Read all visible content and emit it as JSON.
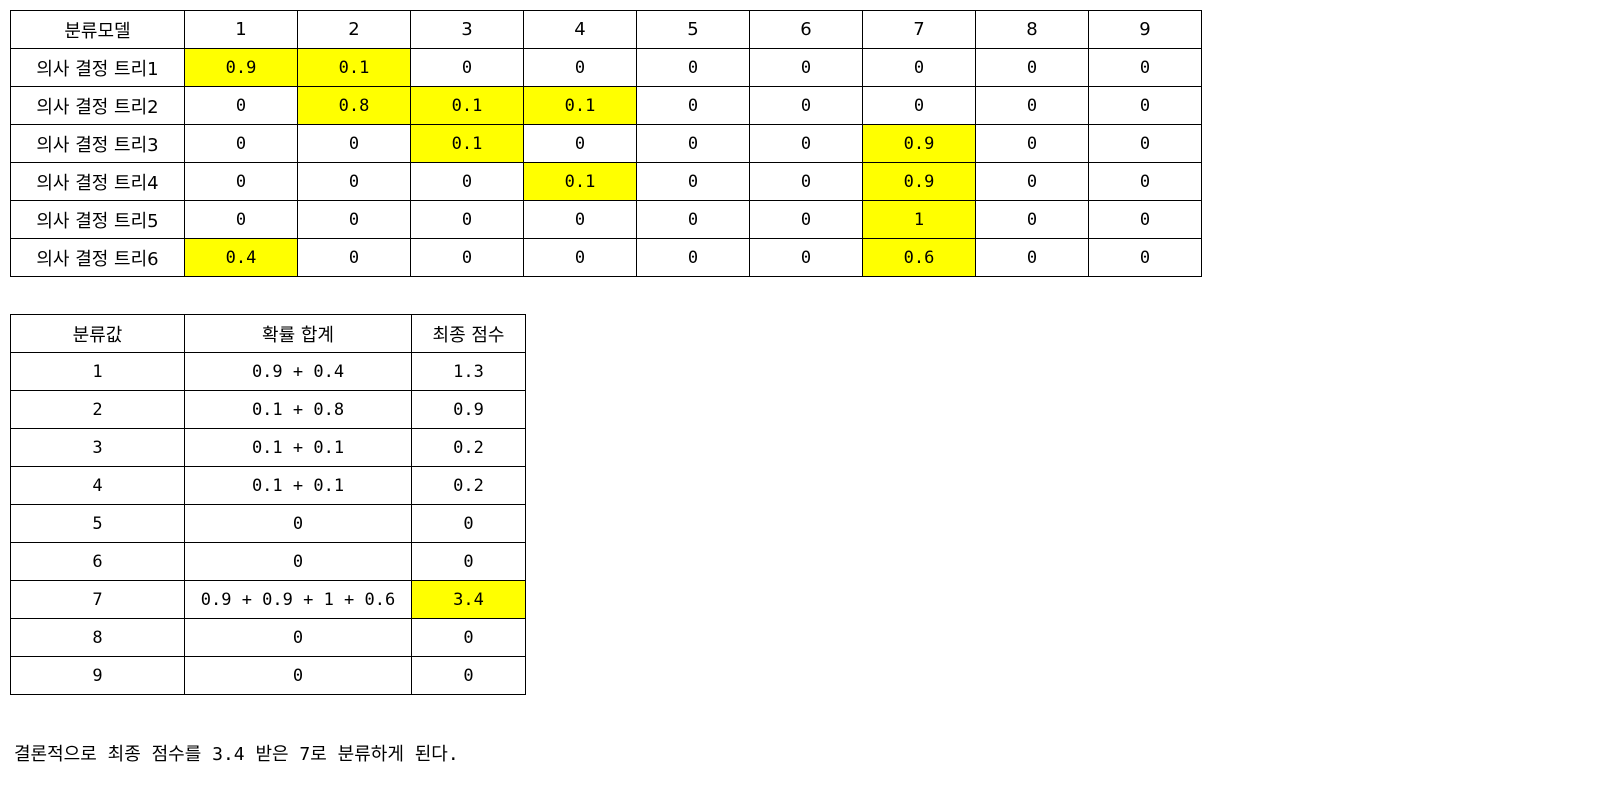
{
  "vote_table": {
    "header": [
      "분류모델",
      "1",
      "2",
      "3",
      "4",
      "5",
      "6",
      "7",
      "8",
      "9"
    ],
    "rows": [
      {
        "label": "의사 결정 트리1",
        "cells": [
          {
            "v": "0.9",
            "hl": true
          },
          {
            "v": "0.1",
            "hl": true
          },
          {
            "v": "0"
          },
          {
            "v": "0"
          },
          {
            "v": "0"
          },
          {
            "v": "0"
          },
          {
            "v": "0"
          },
          {
            "v": "0"
          },
          {
            "v": "0"
          }
        ]
      },
      {
        "label": "의사 결정 트리2",
        "cells": [
          {
            "v": "0"
          },
          {
            "v": "0.8",
            "hl": true
          },
          {
            "v": "0.1",
            "hl": true
          },
          {
            "v": "0.1",
            "hl": true
          },
          {
            "v": "0"
          },
          {
            "v": "0"
          },
          {
            "v": "0"
          },
          {
            "v": "0"
          },
          {
            "v": "0"
          }
        ]
      },
      {
        "label": "의사 결정 트리3",
        "cells": [
          {
            "v": "0"
          },
          {
            "v": "0"
          },
          {
            "v": "0.1",
            "hl": true
          },
          {
            "v": "0"
          },
          {
            "v": "0"
          },
          {
            "v": "0"
          },
          {
            "v": "0.9",
            "hl": true
          },
          {
            "v": "0"
          },
          {
            "v": "0"
          }
        ]
      },
      {
        "label": "의사 결정 트리4",
        "cells": [
          {
            "v": "0"
          },
          {
            "v": "0"
          },
          {
            "v": "0"
          },
          {
            "v": "0.1",
            "hl": true
          },
          {
            "v": "0"
          },
          {
            "v": "0"
          },
          {
            "v": "0.9",
            "hl": true
          },
          {
            "v": "0"
          },
          {
            "v": "0"
          }
        ]
      },
      {
        "label": "의사 결정 트리5",
        "cells": [
          {
            "v": "0"
          },
          {
            "v": "0"
          },
          {
            "v": "0"
          },
          {
            "v": "0"
          },
          {
            "v": "0"
          },
          {
            "v": "0"
          },
          {
            "v": "1",
            "hl": true
          },
          {
            "v": "0"
          },
          {
            "v": "0"
          }
        ]
      },
      {
        "label": "의사 결정 트리6",
        "cells": [
          {
            "v": "0.4",
            "hl": true
          },
          {
            "v": "0"
          },
          {
            "v": "0"
          },
          {
            "v": "0"
          },
          {
            "v": "0"
          },
          {
            "v": "0"
          },
          {
            "v": "0.6",
            "hl": true
          },
          {
            "v": "0"
          },
          {
            "v": "0"
          }
        ]
      }
    ]
  },
  "score_table": {
    "header": [
      "분류값",
      "확률 합계",
      "최종 점수"
    ],
    "rows": [
      {
        "cls": "1",
        "sum": "0.9 + 0.4",
        "score": "1.3"
      },
      {
        "cls": "2",
        "sum": "0.1 + 0.8",
        "score": "0.9"
      },
      {
        "cls": "3",
        "sum": "0.1 + 0.1",
        "score": "0.2"
      },
      {
        "cls": "4",
        "sum": "0.1 + 0.1",
        "score": "0.2"
      },
      {
        "cls": "5",
        "sum": "0",
        "score": "0"
      },
      {
        "cls": "6",
        "sum": "0",
        "score": "0"
      },
      {
        "cls": "7",
        "sum": "0.9 + 0.9 + 1 + 0.6",
        "score": "3.4",
        "hl": true
      },
      {
        "cls": "8",
        "sum": "0",
        "score": "0"
      },
      {
        "cls": "9",
        "sum": "0",
        "score": "0"
      }
    ]
  },
  "conclusion": "결론적으로 최종 점수를 3.4 받은 7로 분류하게 된다.",
  "colors": {
    "highlight": "#ffff00",
    "border": "#000000"
  }
}
